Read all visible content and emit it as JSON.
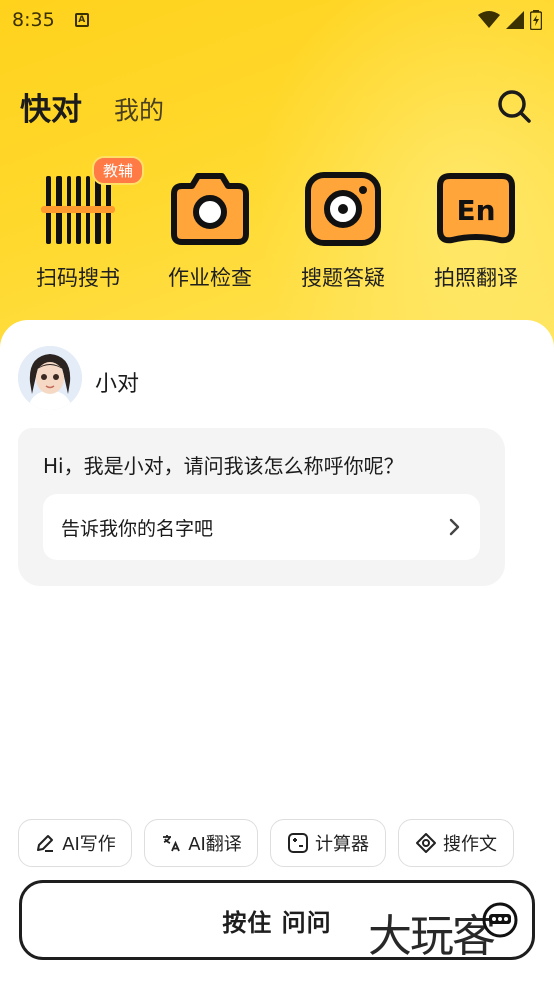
{
  "status_bar": {
    "time": "8:35",
    "notif_glyph": "A"
  },
  "header": {
    "tab_active": "快对",
    "tab_inactive": "我的"
  },
  "tools": [
    {
      "label": "扫码搜书",
      "icon": "barcode-scan-icon",
      "badge": "教辅"
    },
    {
      "label": "作业检查",
      "icon": "camera-icon"
    },
    {
      "label": "搜题答疑",
      "icon": "camera-search-icon"
    },
    {
      "label": "拍照翻译",
      "icon": "translate-en-icon",
      "glyph": "En"
    }
  ],
  "chat": {
    "bot_name": "小对",
    "message": "Hi，我是小对，请问我该怎么称呼你呢？",
    "suggestion": "告诉我你的名字吧"
  },
  "chips": [
    {
      "label": "AI写作",
      "icon": "pen-icon"
    },
    {
      "label": "AI翻译",
      "icon": "translate-icon"
    },
    {
      "label": "计算器",
      "icon": "calculator-icon"
    },
    {
      "label": "搜作文",
      "icon": "compass-icon"
    }
  ],
  "ask_button": {
    "label": "按住 问问"
  },
  "watermark": "大玩客",
  "colors": {
    "brand_yellow": "#ffd21c",
    "accent_orange": "#ff9a2e",
    "badge_orange": "#ff7a45",
    "text_dark": "#1b1b1b"
  }
}
